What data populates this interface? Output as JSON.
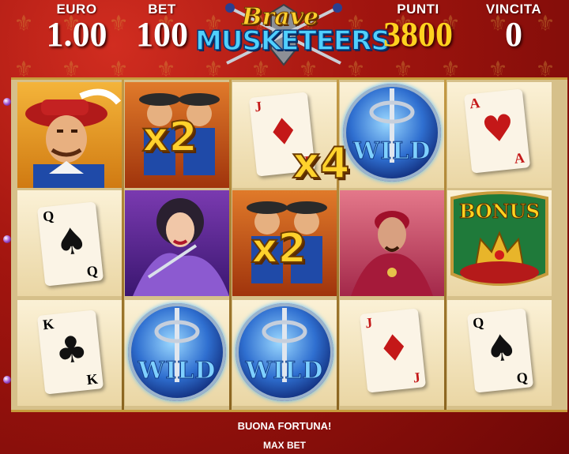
{
  "header": {
    "euro_label": "EURO",
    "euro_value": "1.00",
    "bet_label": "BET",
    "bet_value": "100",
    "punti_label": "PUNTI",
    "punti_value": "3800",
    "vincita_label": "VINCITA",
    "vincita_value": "0"
  },
  "logo": {
    "line1": "Brave",
    "line2": "MUSKETEERS"
  },
  "reels": {
    "wild_text": "WILD",
    "bonus_text": "BONUS",
    "multipliers": {
      "x2": "x2",
      "x4": "x4"
    },
    "cards": {
      "jack": "J",
      "ace": "A",
      "queen": "Q",
      "king": "K"
    }
  },
  "footer": {
    "message": "BUONA FORTUNA!",
    "max_bet": "MAX BET"
  },
  "colors": {
    "accent": "#ffd21f",
    "frame": "#a2150f"
  }
}
